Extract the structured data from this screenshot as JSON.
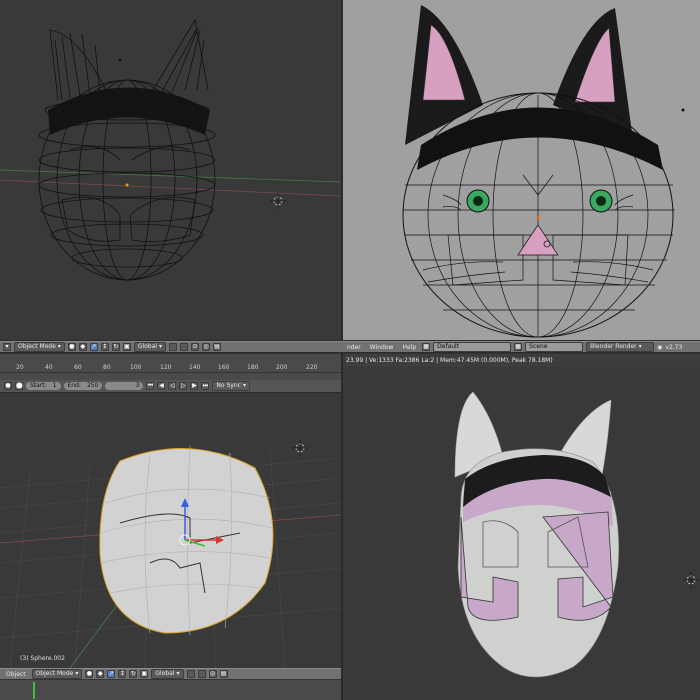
{
  "header_left": {
    "mode": "Object Mode",
    "orientation": "Global"
  },
  "header_right": {
    "menus": [
      "nder",
      "Window",
      "Help"
    ],
    "layout": "Default",
    "scene": "Scene",
    "engine": "Blender Render",
    "version": "v2.73"
  },
  "stats": "23.99 | Ve:1333 Fa:2386 La:2 | Mem:47.45M (0.000M), Peak 78.18M)",
  "ruler": {
    "ticks": [
      "20",
      "40",
      "60",
      "80",
      "100",
      "120",
      "140",
      "160",
      "180",
      "200",
      "220"
    ]
  },
  "timeline": {
    "start_label": "Start:",
    "start_value": "1",
    "end_label": "End:",
    "end_value": "250",
    "current": "3",
    "sync": "No Sync"
  },
  "viewport_bl": {
    "object_label": "(3) Sphere.002"
  },
  "footer_bl": {
    "object_menu": "Object",
    "mode": "Object Mode",
    "orientation": "Global"
  },
  "colors": {
    "viewport_gray": "#393939",
    "ortho_bg": "#a0a0a0",
    "ear_pink": "#d8a0c0",
    "eye_green": "#3aa860",
    "face_lilac": "#c8a8c8"
  }
}
